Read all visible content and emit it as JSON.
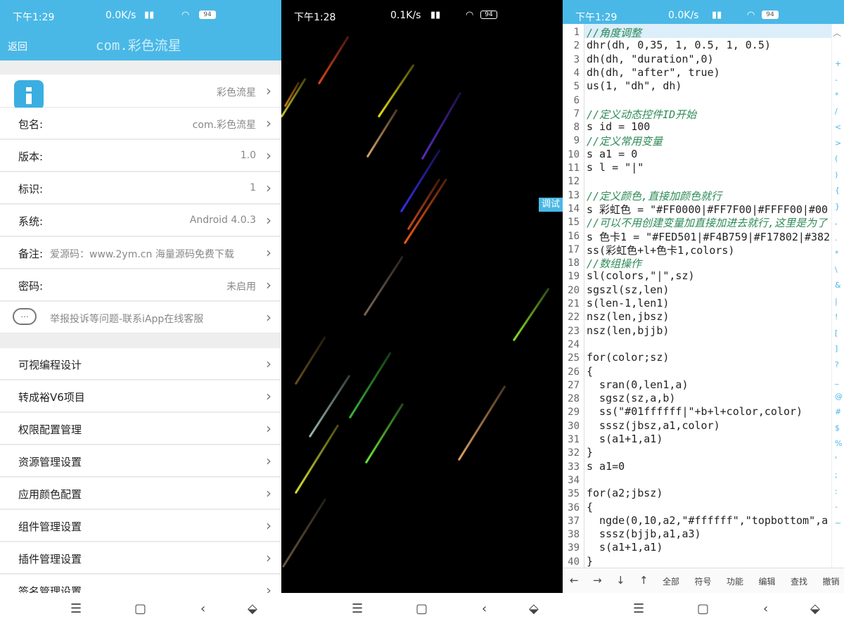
{
  "status1": {
    "time": "下午1:29",
    "speed": "0.0K/s",
    "battery": "94"
  },
  "status2": {
    "time": "下午1:28",
    "speed": "0.1K/s",
    "battery": "94"
  },
  "status3": {
    "time": "下午1:29",
    "speed": "0.0K/s",
    "battery": "94"
  },
  "header": {
    "back": "返回",
    "title": "com.彩色流星"
  },
  "info": {
    "app_name": "彩色流星",
    "rows": [
      {
        "label": "包名:",
        "value": "com.彩色流星"
      },
      {
        "label": "版本:",
        "value": "1.0"
      },
      {
        "label": "标识:",
        "value": "1"
      },
      {
        "label": "系统:",
        "value": "Android 4.0.3"
      },
      {
        "label": "备注:",
        "value": "爱源码：www.2ym.cn 海量源码免费下载"
      },
      {
        "label": "密码:",
        "value": "未启用"
      }
    ],
    "report": "举报投诉等问题-联系iApp在线客服",
    "chat_icon": "..."
  },
  "menu": [
    "可视编程设计",
    "转成裕V6项目",
    "权限配置管理",
    "资源管理设置",
    "应用颜色配置",
    "组件管理设置",
    "插件管理设置",
    "签名管理设置"
  ],
  "chevron": "›",
  "nav": {
    "menu": "☰",
    "home": "▢",
    "back": "‹",
    "down": "⬙"
  },
  "debug": "调试",
  "editor": {
    "lines": [
      "//角度调整",
      "dhr(dh, 0,35, 1, 0.5, 1, 0.5)",
      "dh(dh, \"duration\",0)",
      "dh(dh, \"after\", true)",
      "us(1, \"dh\", dh)",
      "",
      "//定义动态控件ID开始",
      "s id = 100",
      "//定义常用变量",
      "s a1 = 0",
      "s l = \"|\"",
      "",
      "//定义颜色,直接加颜色就行",
      "s 彩虹色 = \"#FF0000|#FF7F00|#FFFF00|#00",
      "//可以不用创建变量加直接加进去就行,这里是为了",
      "s 色卡1 = \"#FED501|#F4B759|#F17802|#382",
      "ss(彩虹色+l+色卡1,colors)",
      "//数组操作",
      "sl(colors,\"|\",sz)",
      "sgszl(sz,len)",
      "s(len-1,len1)",
      "nsz(len,jbsz)",
      "nsz(len,bjjb)",
      "",
      "for(color;sz)",
      "{",
      "  sran(0,len1,a)",
      "  sgsz(sz,a,b)",
      "  ss(\"#01ffffff|\"+b+l+color,color)",
      "  sssz(jbsz,a1,color)",
      "  s(a1+1,a1)",
      "}",
      "s a1=0",
      "",
      "for(a2;jbsz)",
      "{",
      "  ngde(0,10,a2,\"#ffffff\",\"topbottom\",a",
      "  sssz(bjjb,a1,a3)",
      "  s(a1+1,a1)",
      "}"
    ],
    "line_numbers": [
      "1",
      "2",
      "3",
      "4",
      "5",
      "6",
      "7",
      "8",
      "9",
      "10",
      "11",
      "12",
      "13",
      "14",
      "15",
      "16",
      "17",
      "18",
      "19",
      "20",
      "21",
      "22",
      "23",
      "24",
      "25",
      "26",
      "27",
      "28",
      "29",
      "30",
      "31",
      "32",
      "33",
      "34",
      "35",
      "36",
      "37",
      "38",
      "39",
      "40"
    ],
    "symbols": [
      "+",
      "-",
      "*",
      "/",
      "<",
      ">",
      "(",
      ")",
      "{",
      "}",
      ",",
      ".",
      "*",
      "\\",
      "&",
      "|",
      "!",
      "[",
      "]",
      "?",
      "_",
      "@",
      "#",
      "$",
      "%",
      "'",
      ";",
      ":",
      "-",
      "~"
    ],
    "toolbar": [
      "全部",
      "符号",
      "功能",
      "编辑",
      "查找",
      "撤销"
    ],
    "arrows": [
      "←",
      "→",
      "↓",
      "↑"
    ]
  }
}
